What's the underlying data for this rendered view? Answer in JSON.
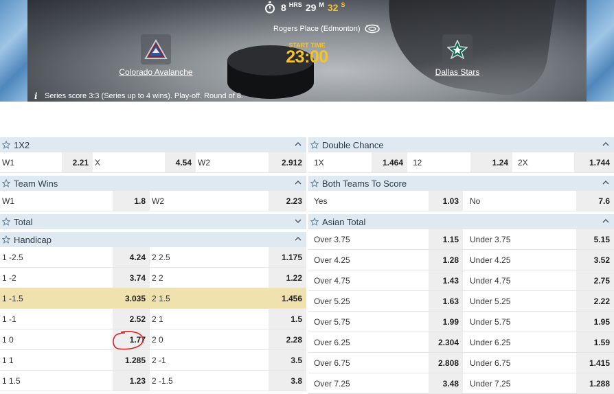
{
  "timer": {
    "hours": "8",
    "hours_unit": "HRS",
    "minutes": "29",
    "minutes_unit": "M",
    "seconds": "32",
    "seconds_unit": "S"
  },
  "venue": "Rogers Place (Edmonton)",
  "home_team": "Colorado Avalanche",
  "away_team": "Dallas Stars",
  "start": {
    "label": "START TIME",
    "time": "23:00"
  },
  "series_info": "Series score 3:3 (Series up to 4 wins). Play-off. Round of 8.",
  "accent_color": "#f5c42b",
  "highlight_color": "#efe2ae",
  "markets_left": {
    "m1x2": {
      "title": "1X2",
      "rows": [
        [
          "W1",
          "2.21",
          "X",
          "4.54",
          "W2",
          "2.912"
        ]
      ]
    },
    "team_wins": {
      "title": "Team Wins",
      "rows": [
        [
          "W1",
          "1.8",
          "W2",
          "2.23"
        ]
      ]
    },
    "total": {
      "title": "Total"
    },
    "handicap": {
      "title": "Handicap",
      "rows": [
        [
          "1 -2.5",
          "4.24",
          "2 2.5",
          "1.175"
        ],
        [
          "1 -2",
          "3.74",
          "2 2",
          "1.22"
        ],
        [
          "1 -1.5",
          "3.035",
          "2 1.5",
          "1.456"
        ],
        [
          "1 -1",
          "2.52",
          "2 1",
          "1.5"
        ],
        [
          "1 0",
          "1.77",
          "2 0",
          "2.28"
        ],
        [
          "1 1",
          "1.285",
          "2 -1",
          "3.5"
        ],
        [
          "1 1.5",
          "1.23",
          "2 -1.5",
          "3.8"
        ]
      ]
    }
  },
  "markets_right": {
    "double_chance": {
      "title": "Double Chance",
      "rows": [
        [
          "1X",
          "1.464",
          "12",
          "1.24",
          "2X",
          "1.744"
        ]
      ]
    },
    "btts": {
      "title": "Both Teams To Score",
      "rows": [
        [
          "Yes",
          "1.03",
          "No",
          "7.6"
        ]
      ]
    },
    "asian_total": {
      "title": "Asian Total",
      "rows": [
        [
          "Over 3.75",
          "1.15",
          "Under 3.75",
          "5.15"
        ],
        [
          "Over 4.25",
          "1.28",
          "Under 4.25",
          "3.52"
        ],
        [
          "Over 4.75",
          "1.43",
          "Under 4.75",
          "2.75"
        ],
        [
          "Over 5.25",
          "1.63",
          "Under 5.25",
          "2.22"
        ],
        [
          "Over 5.75",
          "1.99",
          "Under 5.75",
          "1.95"
        ],
        [
          "Over 6.25",
          "2.304",
          "Under 6.25",
          "1.59"
        ],
        [
          "Over 6.75",
          "2.808",
          "Under 6.75",
          "1.415"
        ],
        [
          "Over 7.25",
          "3.48",
          "Under 7.25",
          "1.288"
        ]
      ]
    }
  }
}
